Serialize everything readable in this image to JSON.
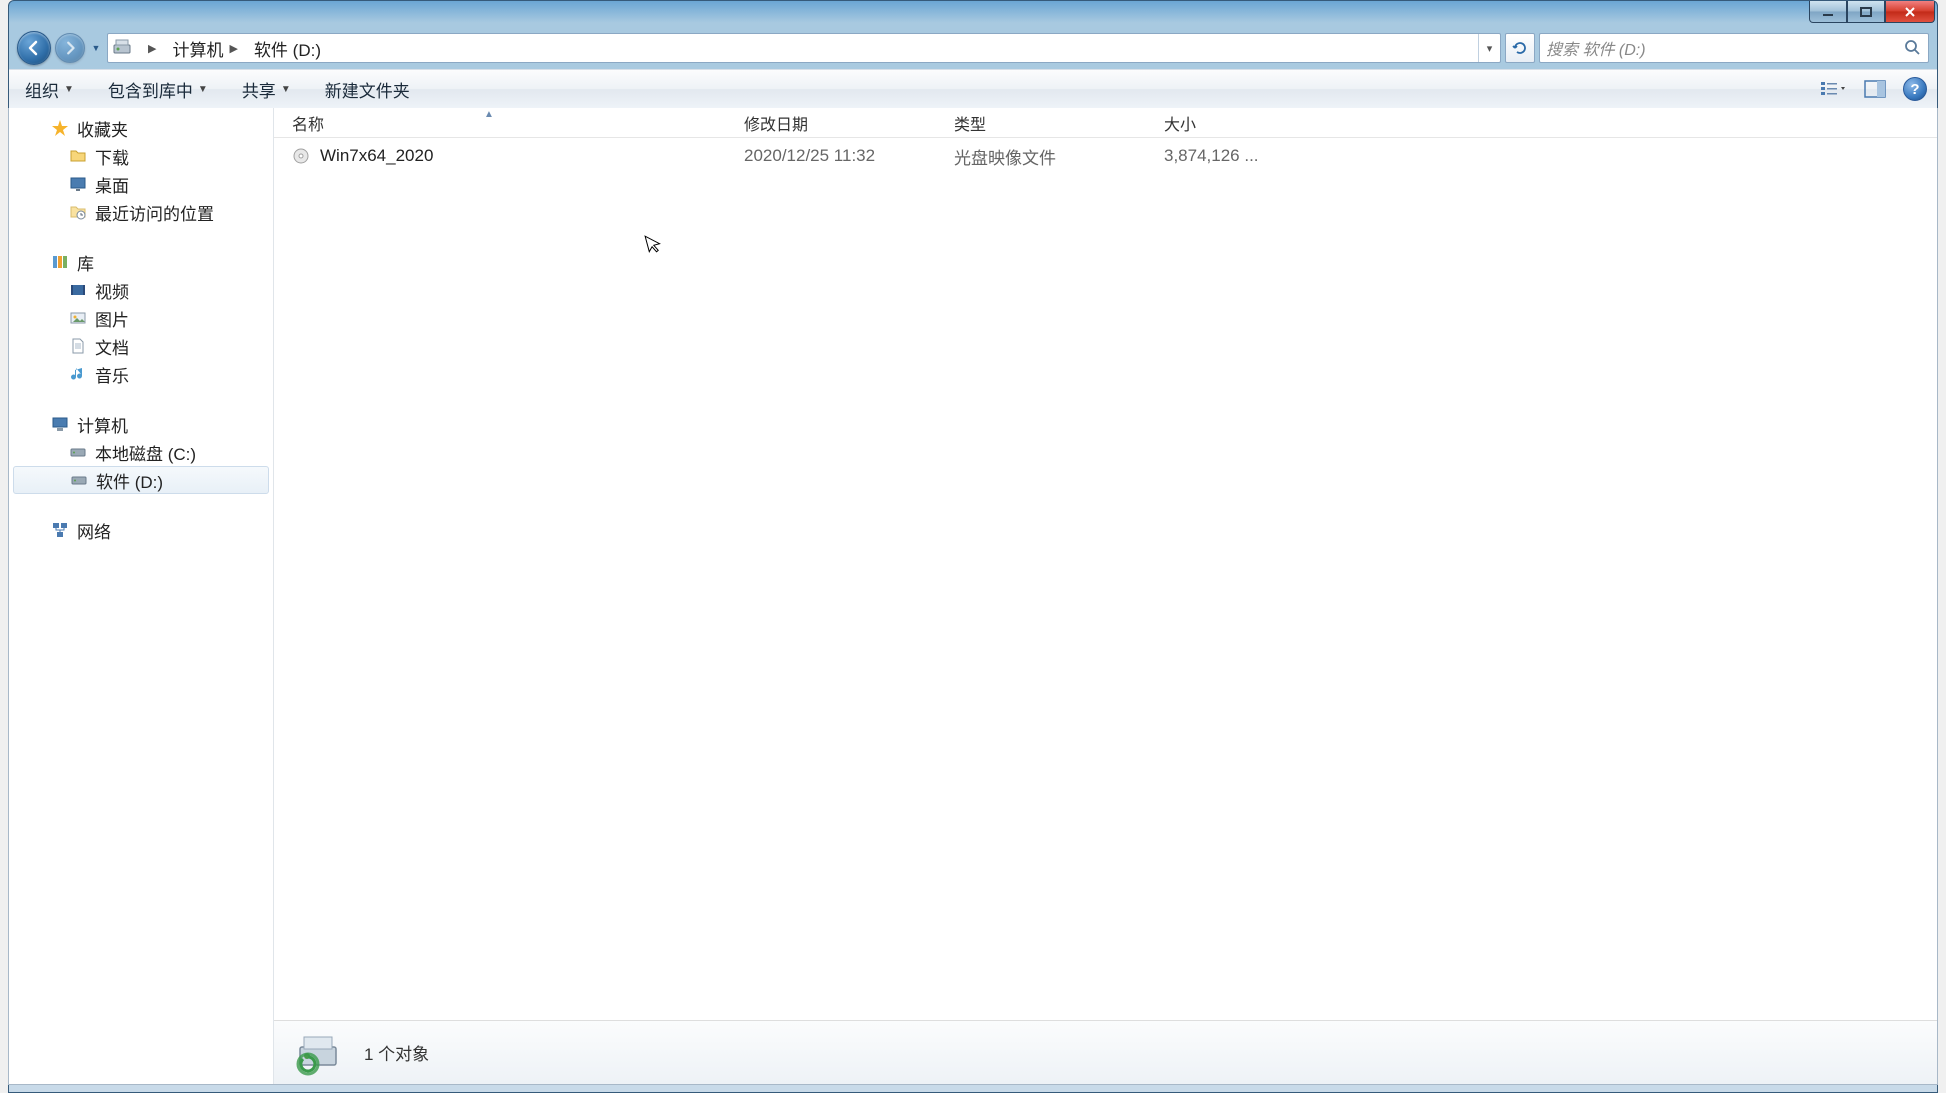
{
  "window": {
    "title": ""
  },
  "nav": {
    "path": {
      "segments": [
        "计算机",
        "软件 (D:)"
      ]
    },
    "search_placeholder": "搜索 软件 (D:)"
  },
  "toolbar": {
    "organize": "组织",
    "include": "包含到库中",
    "share": "共享",
    "new_folder": "新建文件夹"
  },
  "sidebar": {
    "favorites": {
      "label": "收藏夹",
      "items": [
        "下载",
        "桌面",
        "最近访问的位置"
      ]
    },
    "libraries": {
      "label": "库",
      "items": [
        "视频",
        "图片",
        "文档",
        "音乐"
      ]
    },
    "computer": {
      "label": "计算机",
      "items": [
        "本地磁盘 (C:)",
        "软件 (D:)"
      ],
      "selected_index": 1
    },
    "network": {
      "label": "网络"
    }
  },
  "columns": {
    "name": "名称",
    "date": "修改日期",
    "type": "类型",
    "size": "大小"
  },
  "files": [
    {
      "name": "Win7x64_2020",
      "date": "2020/12/25 11:32",
      "type": "光盘映像文件",
      "size": "3,874,126 ..."
    }
  ],
  "status": {
    "text": "1 个对象"
  }
}
